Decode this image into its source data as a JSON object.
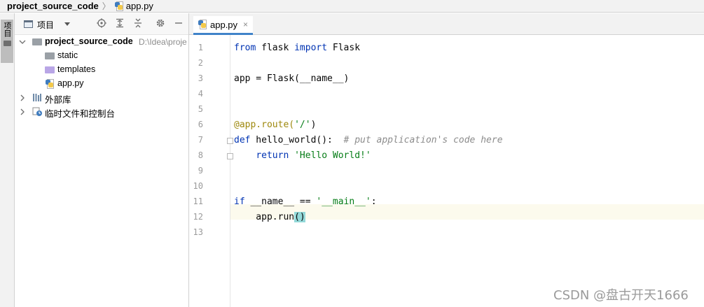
{
  "breadcrumb": {
    "project": "project_source_code",
    "file": "app.py"
  },
  "tool_stripe": {
    "project_tab": "项目"
  },
  "project_panel": {
    "view_selector": "项目",
    "header_icons": [
      "target-icon",
      "expand-all-icon",
      "collapse-all-icon",
      "gear-icon",
      "minimize-icon"
    ],
    "tree": {
      "root": {
        "name": "project_source_code",
        "path": "D:\\Idea\\proje"
      },
      "children": [
        {
          "name": "static",
          "type": "folder"
        },
        {
          "name": "templates",
          "type": "template-folder"
        },
        {
          "name": "app.py",
          "type": "python-file"
        }
      ],
      "external_libs": "外部库",
      "scratches": "临时文件和控制台"
    }
  },
  "editor": {
    "tab": {
      "label": "app.py",
      "close": "×"
    },
    "line_numbers": [
      "1",
      "2",
      "3",
      "4",
      "5",
      "6",
      "7",
      "8",
      "9",
      "10",
      "11",
      "12",
      "13"
    ],
    "code": {
      "l1_kw1": "from",
      "l1_mid": " flask ",
      "l1_kw2": "import",
      "l1_end": " Flask",
      "l3": "app = Flask(__name__)",
      "l6_dec": "@app.route(",
      "l6_str": "'/'",
      "l6_end": ")",
      "l7_kw": "def",
      "l7_mid": " hello_world():  ",
      "l7_cmt": "# put application's code here",
      "l8_indent": "    ",
      "l8_kw": "return",
      "l8_sp": " ",
      "l8_str": "'Hello World!'",
      "l11_kw": "if",
      "l11_mid": " __name__ == ",
      "l11_str": "'__main__'",
      "l11_end": ":",
      "l12_pre": "    app.run",
      "l12_paren": "()"
    },
    "current_line": 12
  },
  "watermark": "CSDN @盘古开天1666",
  "colors": {
    "keyword": "#0033b3",
    "string": "#067d17",
    "comment": "#8c8c8c",
    "current_line": "#fcfaed",
    "tab_underline": "#4083c9"
  }
}
